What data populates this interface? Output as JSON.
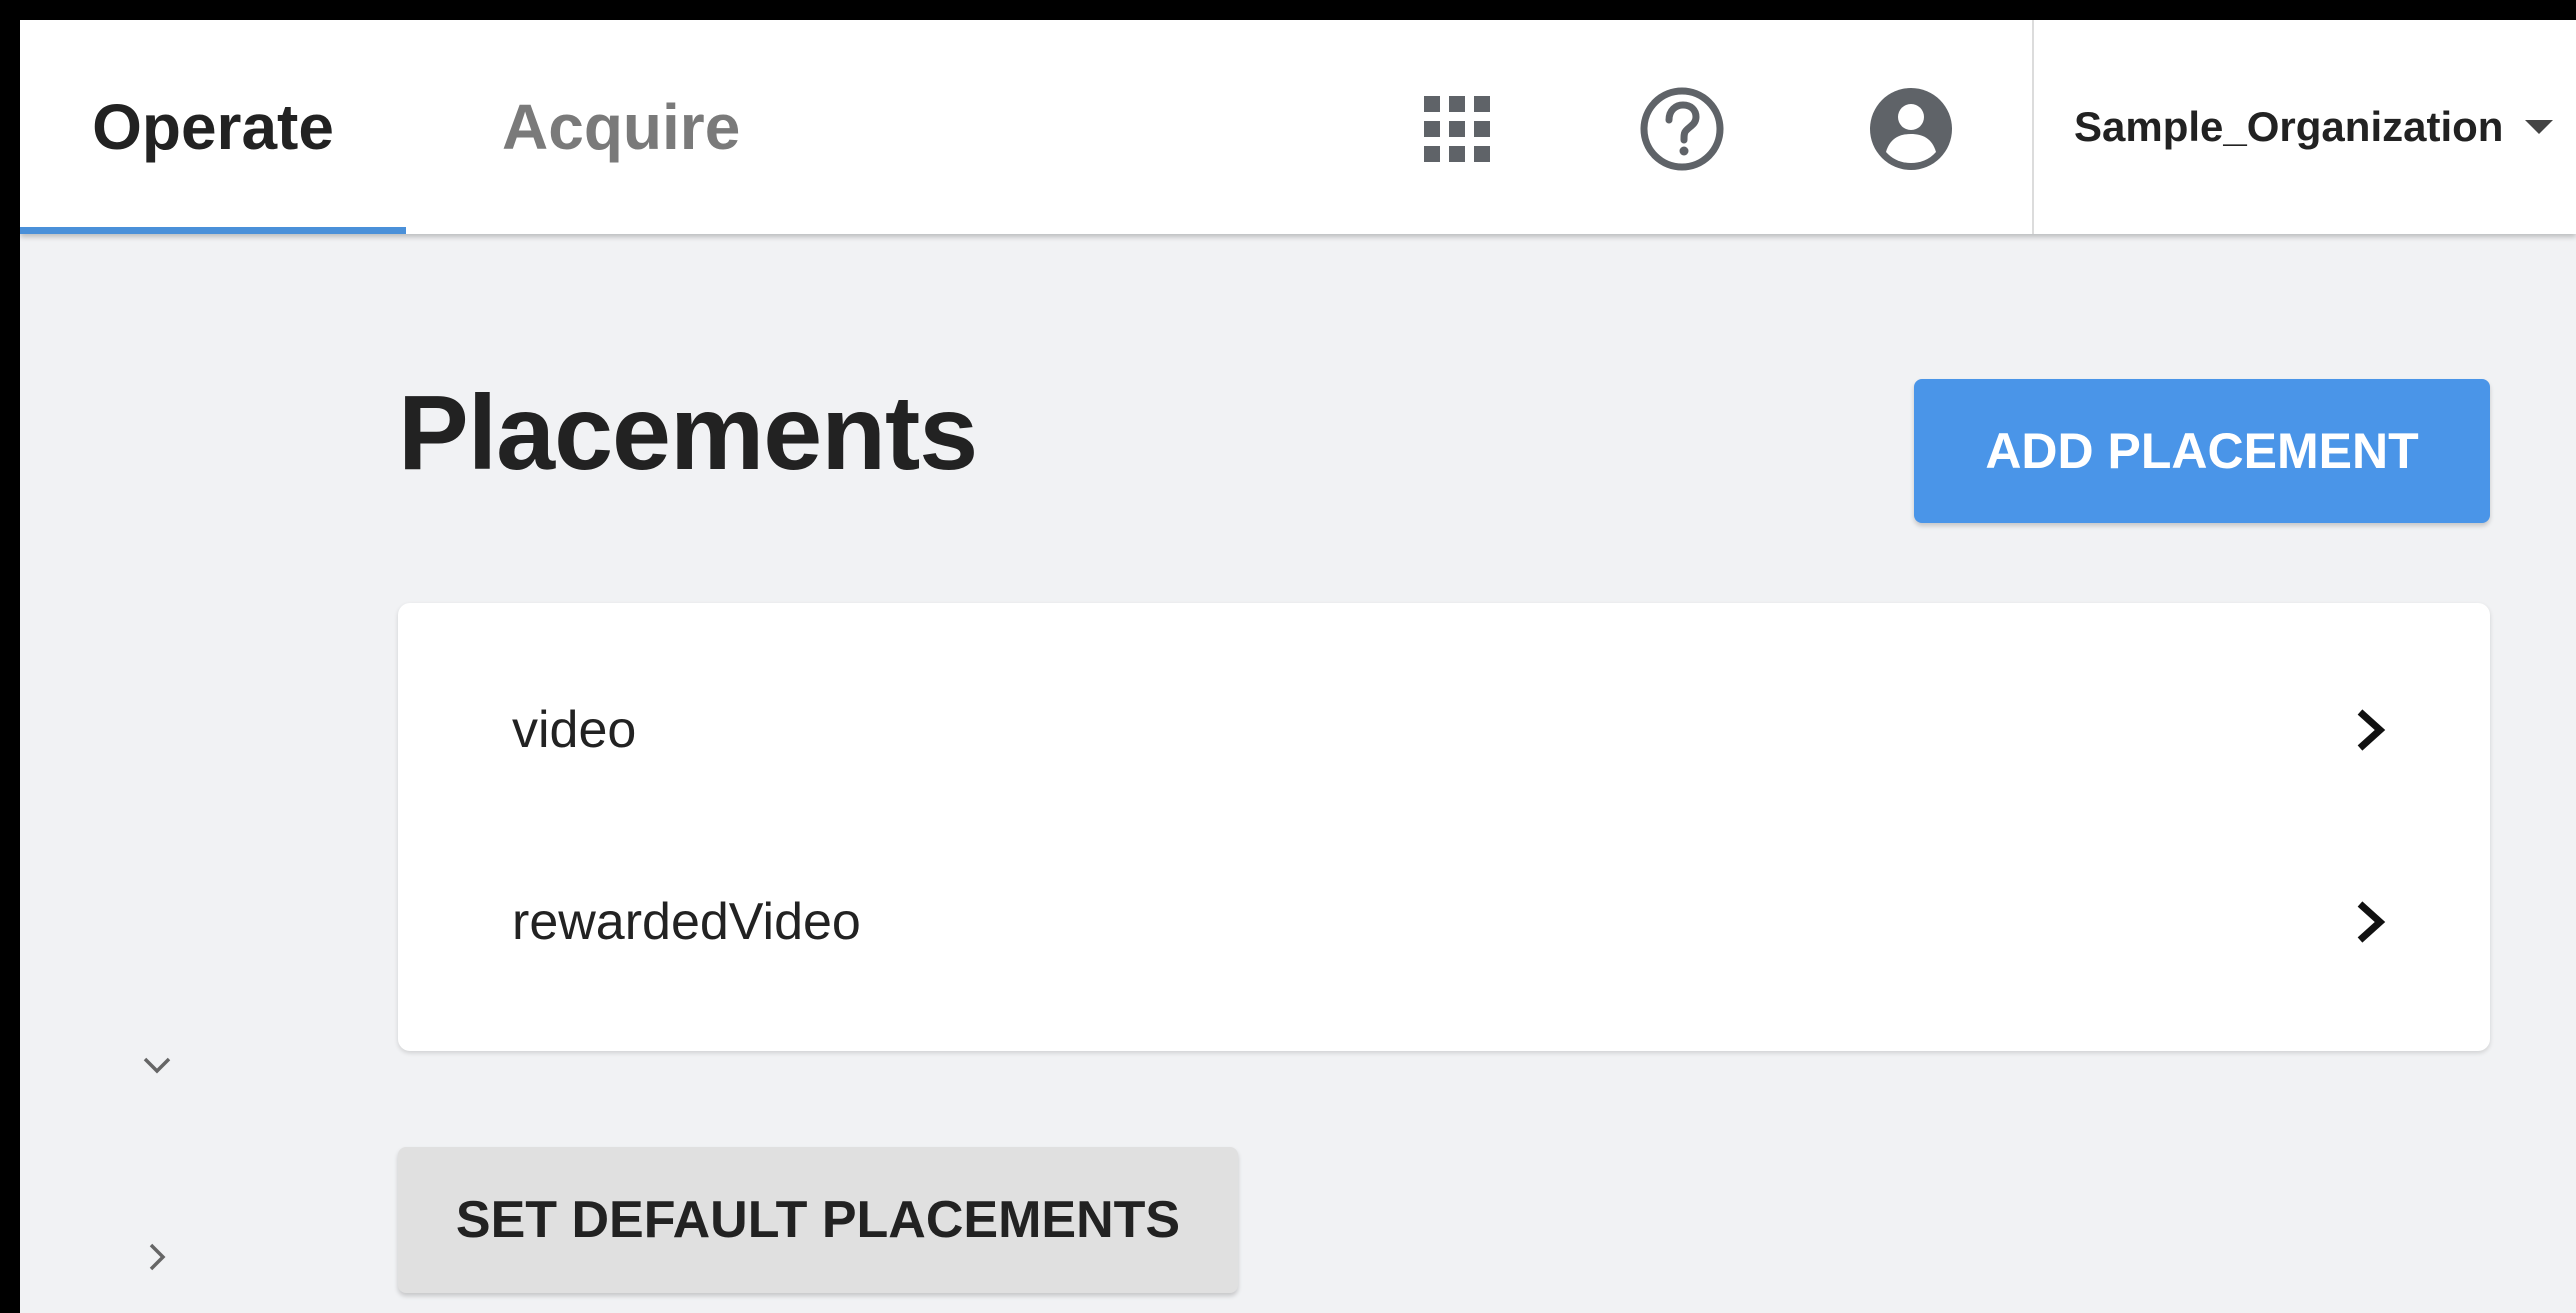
{
  "header": {
    "tabs": [
      {
        "label": "Operate",
        "active": true
      },
      {
        "label": "Acquire",
        "active": false
      }
    ],
    "icons": [
      "apps-grid-icon",
      "help-icon",
      "account-icon"
    ],
    "organization": "Sample_Organization",
    "accent_color": "#4a90d9"
  },
  "main": {
    "title": "Placements",
    "add_button_label": "ADD PLACEMENT",
    "add_button_color": "#4a95e8",
    "placements": [
      {
        "name": "video"
      },
      {
        "name": "rewardedVideo"
      }
    ],
    "default_button_label": "SET DEFAULT PLACEMENTS"
  },
  "sidebar": {
    "icons": [
      "chevron-down-icon",
      "chevron-right-icon"
    ]
  }
}
